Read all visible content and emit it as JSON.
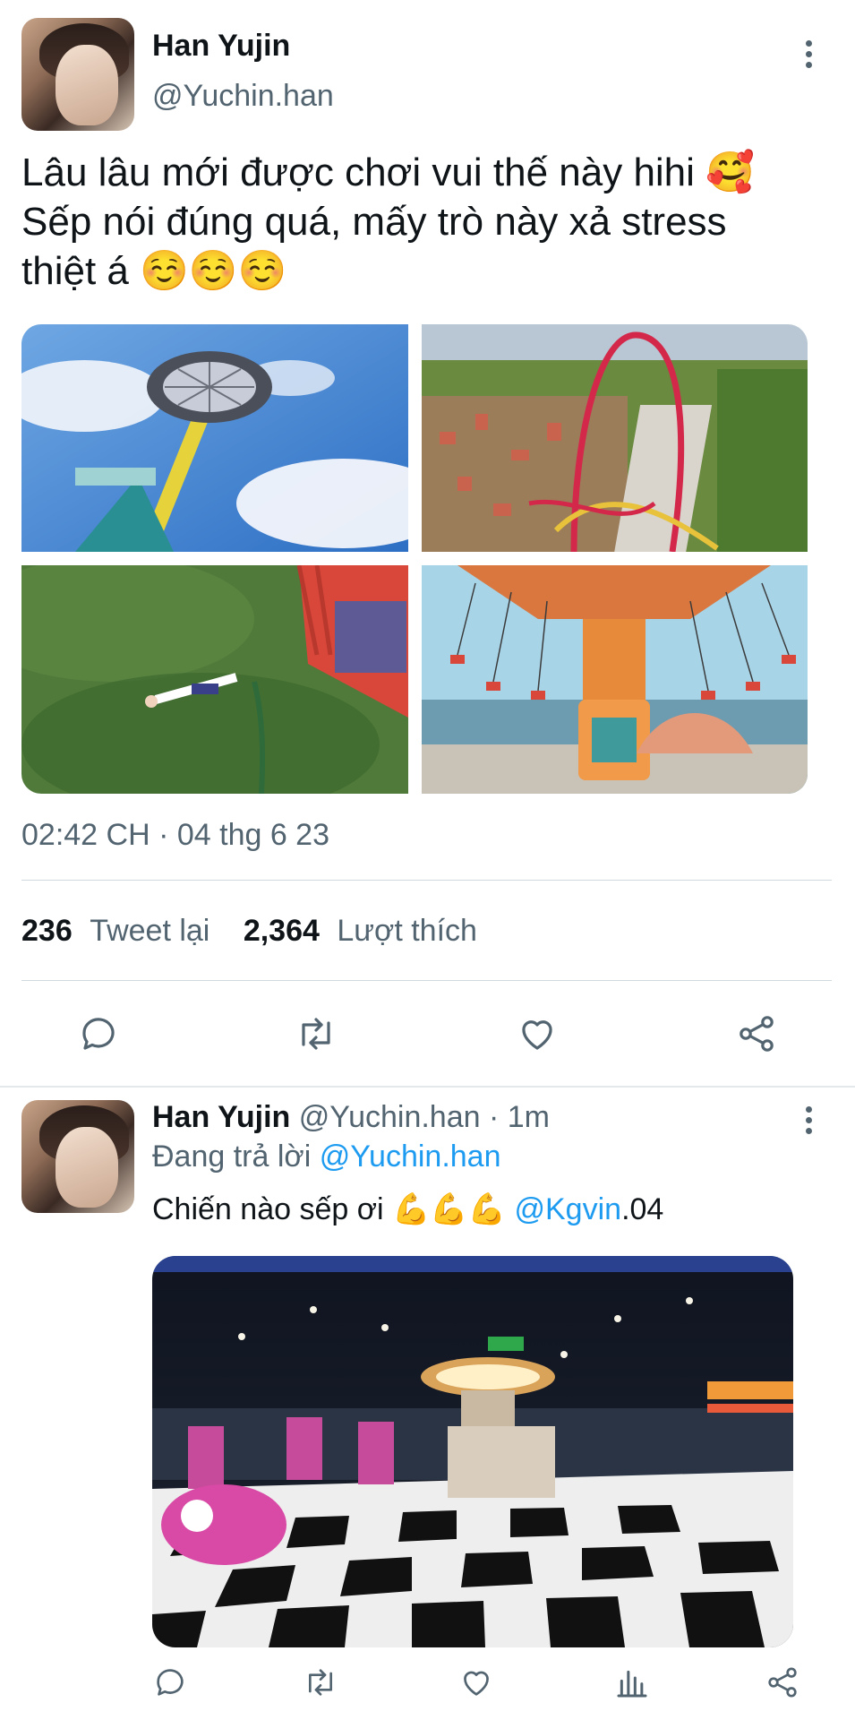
{
  "tweet1": {
    "name": "Han Yujin",
    "handle": "@Yuchin.han",
    "text_line1": "Lâu lâu mới được chơi vui thế này hihi 🥰",
    "text_line2": "Sếp nói đúng quá, mấy trò này xả stress",
    "text_line3": "thiệt á ☺️☺️☺️",
    "timestamp": "02:42 CH · 04 thg 6 23",
    "retweets_count": "236",
    "retweets_label": "Tweet lại",
    "likes_count": "2,364",
    "likes_label": "Lượt thích",
    "photos": [
      {
        "icon": "swing-ride-photo"
      },
      {
        "icon": "roller-coaster-photo"
      },
      {
        "icon": "bungee-jump-photo"
      },
      {
        "icon": "chair-swing-carousel-photo"
      }
    ]
  },
  "reply": {
    "name": "Han Yujin",
    "handle": "@Yuchin.han",
    "time": "· 1m",
    "replying_prefix": "Đang trả lời",
    "replying_handle": "@Yuchin.han",
    "text": "Chiến nào sếp ơi 💪💪💪",
    "mention": "@Kgvin",
    "mention_suffix": ".04",
    "photo": {
      "icon": "arcade-hall-photo"
    }
  },
  "colors": {
    "accent": "#1d9bf0",
    "text": "#0f1419",
    "secondary": "#536471",
    "divider": "#cfd9de"
  }
}
